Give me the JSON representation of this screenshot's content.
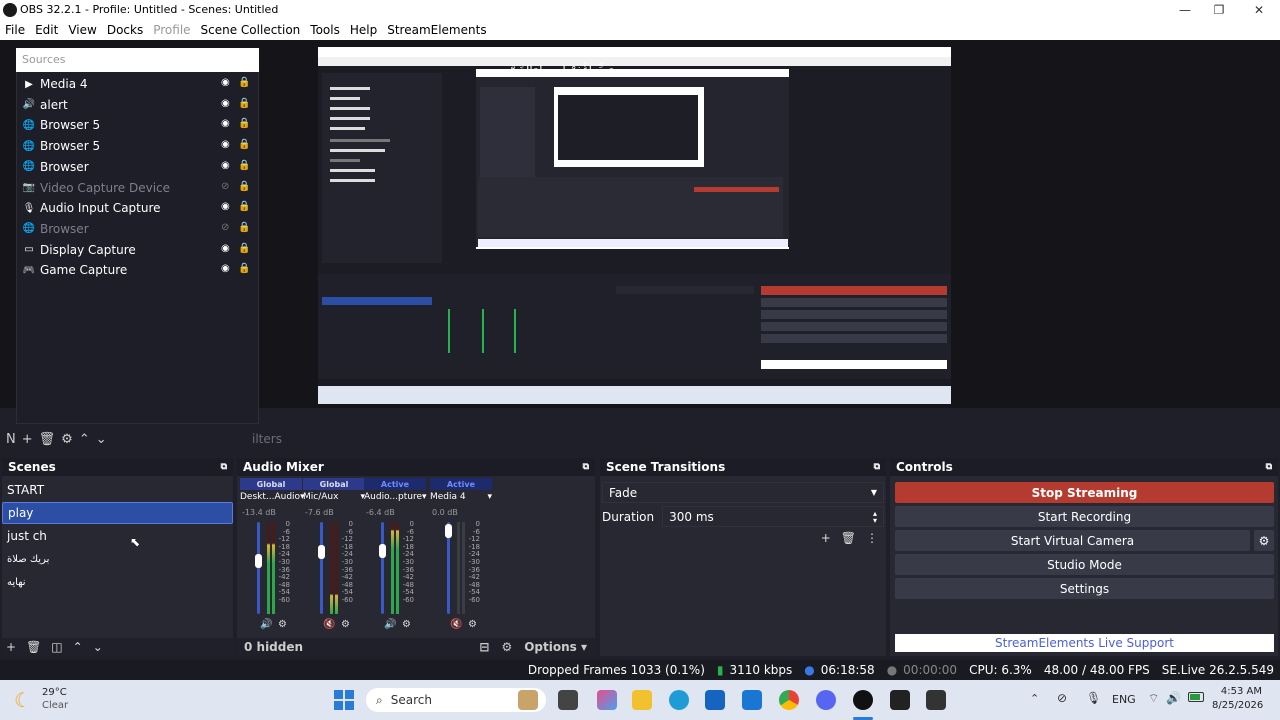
{
  "titlebar": {
    "title": "OBS 32.2.1 - Profile: Untitled - Scenes: Untitled",
    "minimize": "—",
    "maximize": "❐",
    "close": "✕"
  },
  "menubar": [
    "File",
    "Edit",
    "View",
    "Docks",
    "Profile",
    "Scene Collection",
    "Tools",
    "Help",
    "StreamElements"
  ],
  "sources": {
    "header": "Sources",
    "items": [
      {
        "label": "Media 4",
        "icon": "play-icon",
        "hidden": false,
        "locked": false
      },
      {
        "label": "alert",
        "icon": "volume-icon",
        "hidden": false,
        "locked": false
      },
      {
        "label": "Browser 5",
        "icon": "globe-icon",
        "hidden": false,
        "locked": true
      },
      {
        "label": "Browser 5",
        "icon": "globe-icon",
        "hidden": false,
        "locked": true
      },
      {
        "label": "Browser",
        "icon": "globe-icon",
        "hidden": false,
        "locked": false
      },
      {
        "label": "Video Capture Device",
        "icon": "camera-icon",
        "hidden": true,
        "locked": false
      },
      {
        "label": "Audio Input Capture",
        "icon": "mic-icon",
        "hidden": false,
        "locked": true
      },
      {
        "label": "Browser",
        "icon": "globe-icon",
        "hidden": true,
        "locked": true
      },
      {
        "label": "Display Capture",
        "icon": "monitor-icon",
        "hidden": false,
        "locked": true
      },
      {
        "label": "Game Capture",
        "icon": "gamepad-icon",
        "hidden": false,
        "locked": true
      }
    ],
    "toolbar_prefix": "N",
    "filters_tab": "ilters"
  },
  "scenes": {
    "title": "Scenes",
    "items": [
      "START",
      "play",
      "just ch",
      "بريك صلاة",
      "نهايه"
    ],
    "selected": 1
  },
  "mixer": {
    "title": "Audio Mixer",
    "channels": [
      {
        "scope": "Global",
        "name": "Deskt...Audio",
        "db": "-13.4 dB",
        "level": 0.75,
        "fader": 0.58
      },
      {
        "scope": "Global",
        "name": "Mic/Aux",
        "db": "-7.6 dB",
        "level": 0.2,
        "fader": 0.67
      },
      {
        "scope": "Active",
        "name": "Audio...pture",
        "db": "-6.4 dB",
        "level": 0.9,
        "fader": 0.68
      },
      {
        "scope": "Active",
        "name": "Media 4",
        "db": "0.0 dB",
        "level": 0.0,
        "fader": 0.9
      }
    ],
    "scale": [
      "0",
      "-6",
      "-12",
      "-18",
      "-24",
      "-30",
      "-36",
      "-42",
      "-48",
      "-54",
      "-60"
    ],
    "hidden_label": "0 hidden",
    "options_label": "Options"
  },
  "transitions": {
    "title": "Scene Transitions",
    "selected": "Fade",
    "duration_label": "Duration",
    "duration_value": "300 ms"
  },
  "controls": {
    "title": "Controls",
    "buttons": [
      "Stop Streaming",
      "Start Recording",
      "Start Virtual Camera",
      "Studio Mode",
      "Settings"
    ],
    "support": "StreamElements Live Support"
  },
  "status": {
    "dropped": "Dropped Frames 1033 (0.1%)",
    "bitrate": "3110 kbps",
    "stream_time": "06:18:58",
    "rec_time": "00:00:00",
    "cpu": "CPU: 6.3%",
    "fps": "48.00 / 48.00 FPS",
    "version": "SE.Live 26.2.5.549"
  },
  "taskbar": {
    "weather_temp": "29°C",
    "weather_cond": "Clear",
    "search": "Search",
    "lang": "ENG",
    "time": "4:53 AM",
    "date": "8/25/2026"
  },
  "nested": {
    "overlay_text": "رَبِّ اغْفِرْ لِي ولِوَالِدَيَّ"
  },
  "colors": {
    "accent": "#2c4ea5",
    "stop": "#b53b30",
    "bg": "#1e1f29"
  }
}
